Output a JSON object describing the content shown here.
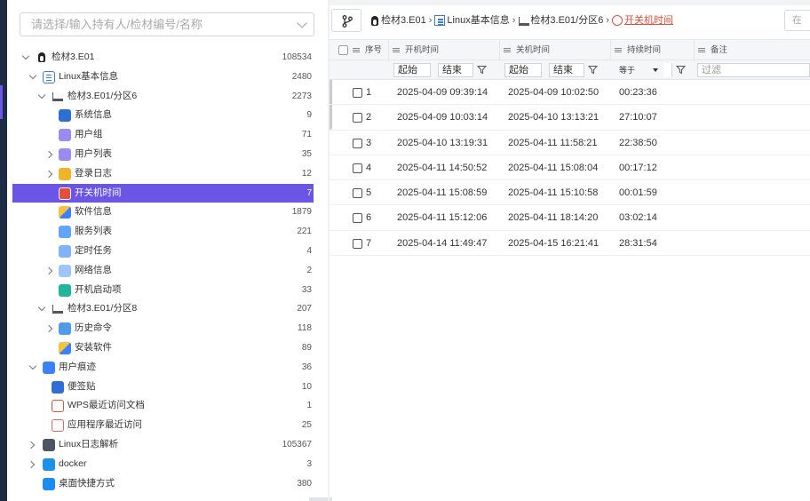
{
  "search": {
    "placeholder": "请选择/输入持有人/检材编号/名称"
  },
  "tree": [
    {
      "label": "检材3.E01",
      "count": "108534",
      "icon": "linux-icon",
      "depth": 0,
      "arrow": "open"
    },
    {
      "label": "Linux基本信息",
      "count": "2480",
      "icon": "list-icon",
      "depth": 1,
      "arrow": "open"
    },
    {
      "label": "检材3.E01/分区6",
      "count": "2273",
      "icon": "disk-icon",
      "depth": 2,
      "arrow": "open"
    },
    {
      "label": "系统信息",
      "count": "9",
      "icon": "system-info-icon",
      "depth": 3,
      "arrow": ""
    },
    {
      "label": "用户组",
      "count": "71",
      "icon": "user-group-icon",
      "depth": 3,
      "arrow": ""
    },
    {
      "label": "用户列表",
      "count": "35",
      "icon": "user-list-icon",
      "depth": 3,
      "arrow": "closed"
    },
    {
      "label": "登录日志",
      "count": "12",
      "icon": "login-log-icon",
      "depth": 3,
      "arrow": "closed"
    },
    {
      "label": "开关机时间",
      "count": "7",
      "icon": "power-icon",
      "depth": 3,
      "arrow": "",
      "active": true
    },
    {
      "label": "软件信息",
      "count": "1879",
      "icon": "software-icon",
      "depth": 3,
      "arrow": ""
    },
    {
      "label": "服务列表",
      "count": "221",
      "icon": "service-icon",
      "depth": 3,
      "arrow": ""
    },
    {
      "label": "定时任务",
      "count": "4",
      "icon": "scheduled-task-icon",
      "depth": 3,
      "arrow": ""
    },
    {
      "label": "网络信息",
      "count": "2",
      "icon": "network-icon",
      "depth": 3,
      "arrow": "closed"
    },
    {
      "label": "开机启动项",
      "count": "33",
      "icon": "boot-item-icon",
      "depth": 3,
      "arrow": ""
    },
    {
      "label": "检材3.E01/分区8",
      "count": "207",
      "icon": "disk-icon",
      "depth": 2,
      "arrow": "open"
    },
    {
      "label": "历史命令",
      "count": "118",
      "icon": "history-icon",
      "depth": 3,
      "arrow": "closed"
    },
    {
      "label": "安装软件",
      "count": "89",
      "icon": "software-icon",
      "depth": 3,
      "arrow": ""
    },
    {
      "label": "用户痕迹",
      "count": "36",
      "icon": "user-trace-icon",
      "depth": 1,
      "arrow": "open"
    },
    {
      "label": "便签贴",
      "count": "10",
      "icon": "note-icon",
      "depth": 2,
      "arrow": ""
    },
    {
      "label": "WPS最近访问文档",
      "count": "1",
      "icon": "wps-clock-icon",
      "depth": 2,
      "arrow": ""
    },
    {
      "label": "应用程序最近访问",
      "count": "25",
      "icon": "app-clock-icon",
      "depth": 2,
      "arrow": ""
    },
    {
      "label": "Linux日志解析",
      "count": "105367",
      "icon": "log-parse-icon",
      "depth": 1,
      "arrow": "closed"
    },
    {
      "label": "docker",
      "count": "3",
      "icon": "docker-icon",
      "depth": 1,
      "arrow": "closed"
    },
    {
      "label": "桌面快捷方式",
      "count": "380",
      "icon": "desktop-shortcut-icon",
      "depth": 1,
      "arrow": ""
    }
  ],
  "breadcrumb": [
    {
      "label": "检材3.E01",
      "icon": "linux-icon"
    },
    {
      "label": "Linux基本信息",
      "icon": "list-icon"
    },
    {
      "label": "检材3.E01/分区6",
      "icon": "disk-icon"
    },
    {
      "label": "开关机时间",
      "icon": "power-icon",
      "current": true
    }
  ],
  "right_button": {
    "label": "在"
  },
  "table": {
    "columns": [
      "序号",
      "开机时间",
      "关机时间",
      "持续时间",
      "备注"
    ],
    "filters": {
      "start": "起始",
      "end": "结束",
      "operator": "等于",
      "search_placeholder": "过滤"
    },
    "rows": [
      {
        "idx": "1",
        "on": "2025-04-09 09:39:14",
        "off": "2025-04-09 10:02:50",
        "duration": "00:23:36"
      },
      {
        "idx": "2",
        "on": "2025-04-09 10:03:14",
        "off": "2025-04-10 13:13:21",
        "duration": "27:10:07"
      },
      {
        "idx": "3",
        "on": "2025-04-10 13:19:31",
        "off": "2025-04-11 11:58:21",
        "duration": "22:38:50"
      },
      {
        "idx": "4",
        "on": "2025-04-11 14:50:52",
        "off": "2025-04-11 15:08:04",
        "duration": "00:17:12"
      },
      {
        "idx": "5",
        "on": "2025-04-11 15:08:59",
        "off": "2025-04-11 15:10:58",
        "duration": "00:01:59"
      },
      {
        "idx": "6",
        "on": "2025-04-11 15:12:06",
        "off": "2025-04-11 18:14:20",
        "duration": "03:02:14"
      },
      {
        "idx": "7",
        "on": "2025-04-14 11:49:47",
        "off": "2025-04-15 16:21:41",
        "duration": "28:31:54"
      }
    ]
  },
  "colors": {
    "accent": "#6a55e6",
    "current_crumb": "#e74c3c",
    "sidebar": "#1f2a44"
  }
}
